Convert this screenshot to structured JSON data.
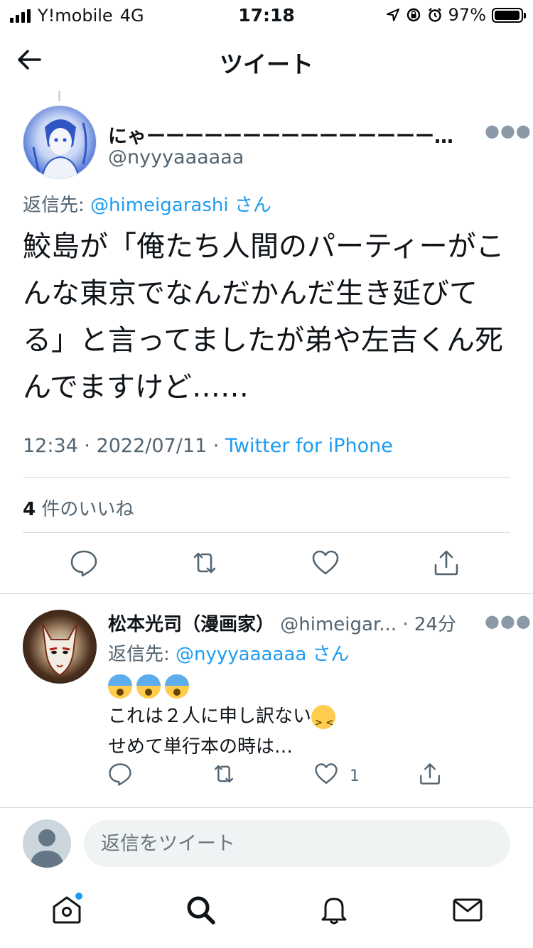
{
  "status_bar": {
    "carrier": "Y!mobile",
    "network": "4G",
    "time": "17:18",
    "battery": "97%",
    "battery_level": 0.97
  },
  "header": {
    "title": "ツイート"
  },
  "tweet": {
    "author_name": "にゃーーーーーーーーーーーーーーーーーーーーー",
    "author_handle": "@nyyyaaaaaa",
    "reply_to_label": "返信先: ",
    "reply_to_handle": "@himeigarashi",
    "reply_to_suffix": " さん",
    "text": "鮫島が「俺たち人間のパーティーがこんな東京でなんだかんだ生き延びてる」と言ってましたが弟や左吉くん死んでますけど……",
    "time": "12:34",
    "date": "2022/07/11",
    "source": "Twitter for iPhone",
    "likes_count": "4",
    "likes_label": "件のいいね"
  },
  "reply": {
    "author_name": "松本光司（漫画家）",
    "author_handle": "@himeigar...",
    "time_ago": "24分",
    "reply_to_label": "返信先: ",
    "reply_to_handle": "@nyyyaaaaaa",
    "reply_to_suffix": " さん",
    "line2": "これは２人に申し訳ない",
    "line3": "せめて単行本の時は…",
    "like_count": "1"
  },
  "compose": {
    "placeholder": "返信をツイート"
  },
  "colors": {
    "accent": "#1d9bf0",
    "secondary_text": "#536471",
    "divider": "#cfd9de"
  },
  "icons": {
    "back": "arrow-left-icon",
    "reply": "comment-icon",
    "retweet": "retweet-icon",
    "like": "heart-icon",
    "share": "share-icon",
    "home": "home-icon",
    "search": "search-icon",
    "notifications": "bell-icon",
    "messages": "envelope-icon"
  }
}
